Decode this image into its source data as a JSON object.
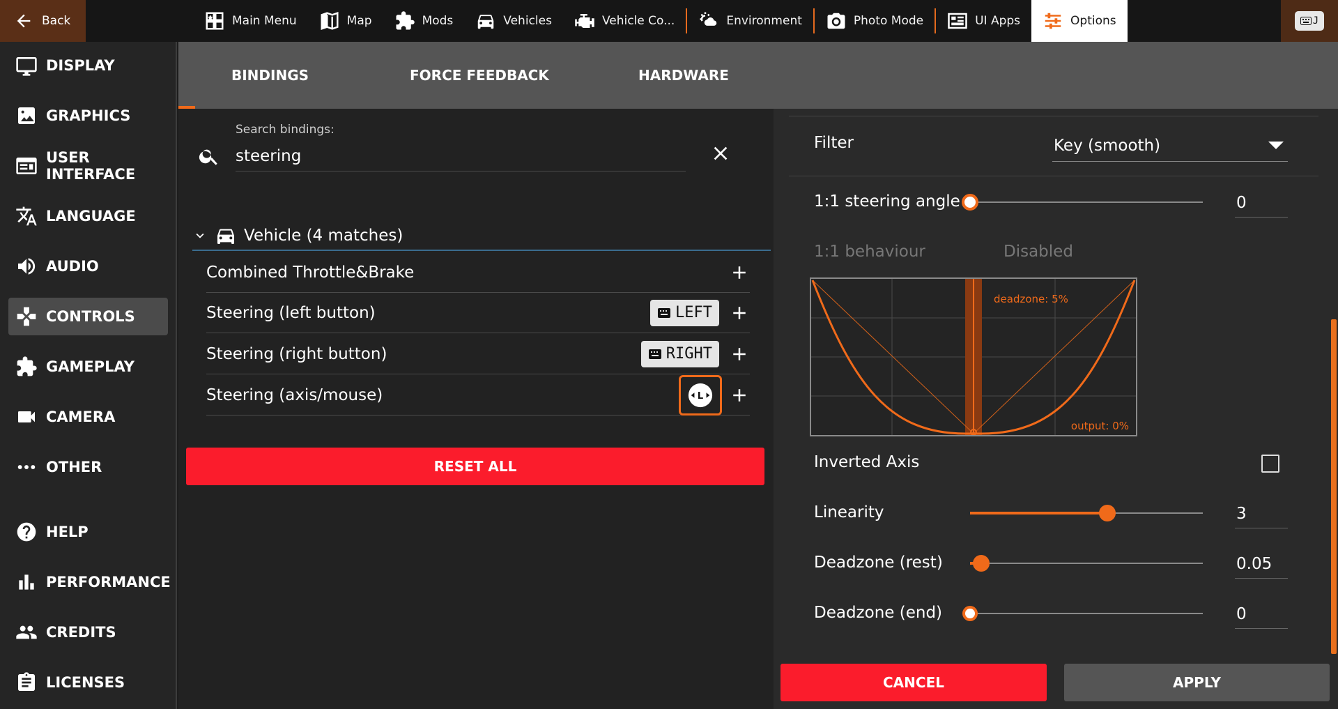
{
  "topbar": {
    "back_label": "Back",
    "nav": [
      {
        "label": "Main Menu",
        "icon": "main-menu-icon"
      },
      {
        "label": "Map",
        "icon": "map-icon"
      },
      {
        "label": "Mods",
        "icon": "puzzle-icon"
      },
      {
        "label": "Vehicles",
        "icon": "car-icon"
      },
      {
        "label": "Vehicle Co...",
        "icon": "engine-icon"
      },
      {
        "label": "Environment",
        "icon": "weather-icon"
      },
      {
        "label": "Photo Mode",
        "icon": "camera-icon"
      },
      {
        "label": "UI Apps",
        "icon": "ui-apps-icon"
      },
      {
        "label": "Options",
        "icon": "options-icon"
      }
    ],
    "active": "Options",
    "corner_key": "J"
  },
  "sidebar": {
    "items": [
      {
        "label": "DISPLAY",
        "icon": "monitor-icon"
      },
      {
        "label": "GRAPHICS",
        "icon": "image-icon"
      },
      {
        "label": "USER INTERFACE",
        "icon": "ui-icon"
      },
      {
        "label": "LANGUAGE",
        "icon": "translate-icon"
      },
      {
        "label": "AUDIO",
        "icon": "speaker-icon"
      },
      {
        "label": "CONTROLS",
        "icon": "gamepad-icon"
      },
      {
        "label": "GAMEPLAY",
        "icon": "puzzle-icon"
      },
      {
        "label": "CAMERA",
        "icon": "videocam-icon"
      },
      {
        "label": "OTHER",
        "icon": "dots-icon"
      },
      {
        "label": "HELP",
        "icon": "help-icon"
      },
      {
        "label": "PERFORMANCE",
        "icon": "bar-chart-icon"
      },
      {
        "label": "CREDITS",
        "icon": "people-icon"
      },
      {
        "label": "LICENSES",
        "icon": "clipboard-icon"
      }
    ],
    "active": "CONTROLS"
  },
  "tabs": [
    "BINDINGS",
    "FORCE FEEDBACK",
    "HARDWARE"
  ],
  "active_tab": "BINDINGS",
  "search": {
    "label": "Search bindings:",
    "value": "steering"
  },
  "group": {
    "title": "Vehicle (4 matches)"
  },
  "bindings": [
    {
      "label": "Combined Throttle&Brake"
    },
    {
      "label": "Steering (left button)",
      "key": "LEFT"
    },
    {
      "label": "Steering (right button)",
      "key": "RIGHT"
    },
    {
      "label": "Steering (axis/mouse)",
      "axis": "L"
    }
  ],
  "reset_label": "RESET ALL",
  "details": {
    "filter_label": "Filter",
    "filter_value": "Key (smooth)",
    "steering_angle_label": "1:1 steering angle",
    "steering_angle_value": "0",
    "behaviour_label": "1:1 behaviour",
    "behaviour_value": "Disabled",
    "graph": {
      "deadzone_label": "deadzone: 5%",
      "output_label": "output: 0%"
    },
    "inverted_label": "Inverted Axis",
    "inverted_checked": false,
    "linearity_label": "Linearity",
    "linearity_value": "3",
    "linearity_fraction": 0.59,
    "deadzone_rest_label": "Deadzone (rest)",
    "deadzone_rest_value": "0.05",
    "deadzone_end_label": "Deadzone (end)",
    "deadzone_end_value": "0"
  },
  "cancel_label": "CANCEL",
  "apply_label": "APPLY",
  "colors": {
    "accent": "#f06a1a",
    "danger": "#fb1c2c"
  }
}
